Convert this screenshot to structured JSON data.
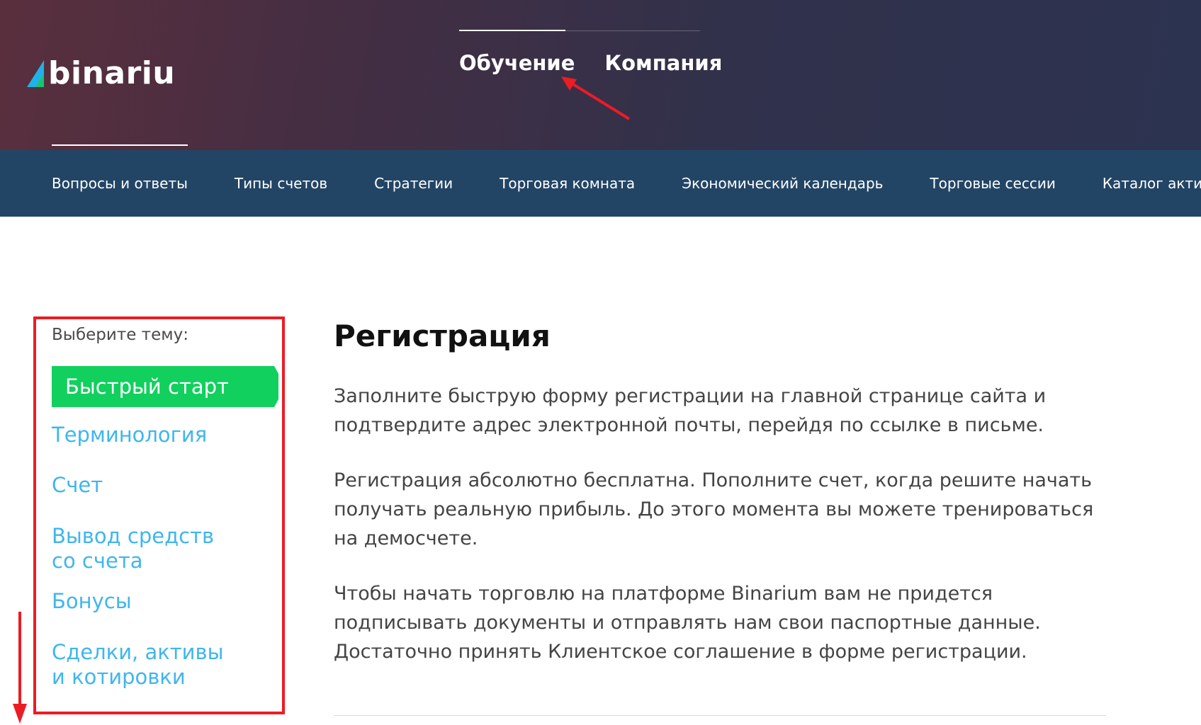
{
  "header": {
    "logo_text": "binariu",
    "brand_colors": {
      "mark_primary": "#1fb2e6",
      "mark_secondary": "#19c46c"
    },
    "top_nav": [
      {
        "label": "Обучение",
        "active": true
      },
      {
        "label": "Компания",
        "active": false
      }
    ]
  },
  "subnav": {
    "items": [
      {
        "label": "Вопросы и ответы",
        "active": true
      },
      {
        "label": "Типы счетов",
        "active": false
      },
      {
        "label": "Стратегии",
        "active": false
      },
      {
        "label": "Торговая комната",
        "active": false
      },
      {
        "label": "Экономический календарь",
        "active": false
      },
      {
        "label": "Торговые сессии",
        "active": false
      },
      {
        "label": "Каталог активов",
        "active": false
      }
    ]
  },
  "sidebar": {
    "title": "Выберите тему:",
    "active_topic": "Быстрый старт",
    "topics": [
      {
        "line1": "Терминология",
        "line2": ""
      },
      {
        "line1": "Счет",
        "line2": ""
      },
      {
        "line1": "Вывод средств",
        "line2": "со счета"
      },
      {
        "line1": "Бонусы",
        "line2": ""
      },
      {
        "line1": "Сделки, активы",
        "line2": "и котировки"
      }
    ]
  },
  "main": {
    "title": "Регистрация",
    "paragraphs": [
      {
        "line1": "Заполните быструю форму регистрации на главной странице сайта и",
        "line2": "подтвердите адрес электронной почты, перейдя по ссылке в письме.",
        "line3": ""
      },
      {
        "line1": "Регистрация абсолютно бесплатна. Пополните счет, когда решите начать",
        "line2": "получать реальную прибыль. До этого момента вы можете тренироваться",
        "line3": "на демосчете."
      },
      {
        "line1": "Чтобы начать торговлю на платформе Binarium вам не придется",
        "line2": "подписывать документы и отправлять нам свои паспортные данные.",
        "line3": "Достаточно принять Клиентское соглашение в форме регистрации."
      }
    ]
  },
  "colors": {
    "header_bg_left": "#5a2f3d",
    "header_bg_right": "#2c3350",
    "subnav_bg": "#234565",
    "active_topic_bg": "#11d05e",
    "topic_link": "#3fb6ee",
    "annotation_red": "#ec1c24"
  }
}
